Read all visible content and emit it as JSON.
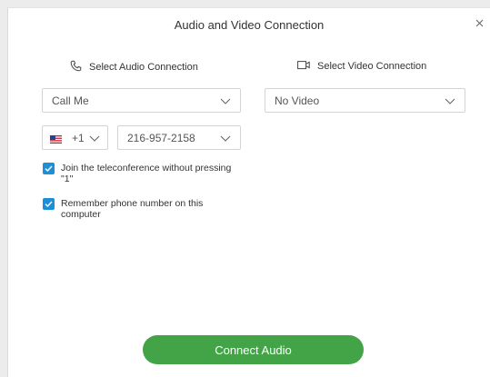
{
  "dialog": {
    "title": "Audio and Video Connection",
    "close_icon": "close-icon"
  },
  "audio": {
    "heading": "Select Audio Connection",
    "heading_icon": "phone-icon",
    "selected_option": "Call Me",
    "country_code": "+1",
    "country_flag": "us-flag-icon",
    "phone_number": "216-957-2158"
  },
  "video": {
    "heading": "Select Video Connection",
    "heading_icon": "video-camera-icon",
    "selected_option": "No Video"
  },
  "options": [
    {
      "label": "Join the teleconference without pressing \"1\"",
      "checked": true
    },
    {
      "label": "Remember phone number on this computer",
      "checked": true
    }
  ],
  "connect_button": {
    "label": "Connect Audio"
  },
  "colors": {
    "accent_button": "#43a447",
    "checkbox": "#1d8fd8"
  }
}
